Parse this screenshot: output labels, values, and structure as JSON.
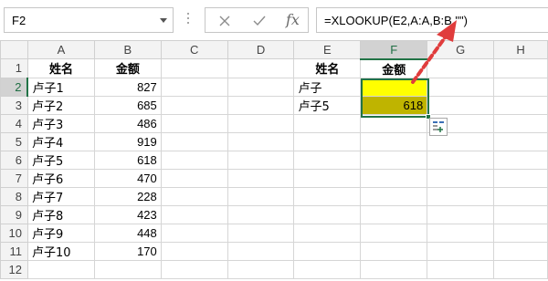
{
  "formula_bar": {
    "name_box": "F2",
    "formula": "=XLOOKUP(E2,A:A,B:B,\"\")",
    "icons": {
      "cancel": "close-icon",
      "enter": "check-icon",
      "function": "fx-icon"
    },
    "fx_label": "fx"
  },
  "sheet": {
    "columns": [
      "A",
      "B",
      "C",
      "D",
      "E",
      "F",
      "G",
      "H"
    ],
    "rows": [
      "1",
      "2",
      "3",
      "4",
      "5",
      "6",
      "7",
      "8",
      "9",
      "10",
      "11",
      "12"
    ],
    "headers": {
      "a1": "姓名",
      "b1": "金额",
      "e1": "姓名",
      "f1": "金额"
    },
    "data": [
      {
        "name": "卢子1",
        "amount": "827"
      },
      {
        "name": "卢子2",
        "amount": "685"
      },
      {
        "name": "卢子3",
        "amount": "486"
      },
      {
        "name": "卢子4",
        "amount": "919"
      },
      {
        "name": "卢子5",
        "amount": "618"
      },
      {
        "name": "卢子6",
        "amount": "470"
      },
      {
        "name": "卢子7",
        "amount": "228"
      },
      {
        "name": "卢子8",
        "amount": "423"
      },
      {
        "name": "卢子9",
        "amount": "448"
      },
      {
        "name": "卢子10",
        "amount": "170"
      }
    ],
    "lookup": [
      {
        "name": "卢子",
        "result": ""
      },
      {
        "name": "卢子5",
        "result": "618"
      }
    ],
    "selected_cell": "F2",
    "colors": {
      "yellow": "#ffff00",
      "olive": "#bfb400",
      "selection": "#217346",
      "arrow": "#e03c3c"
    }
  }
}
